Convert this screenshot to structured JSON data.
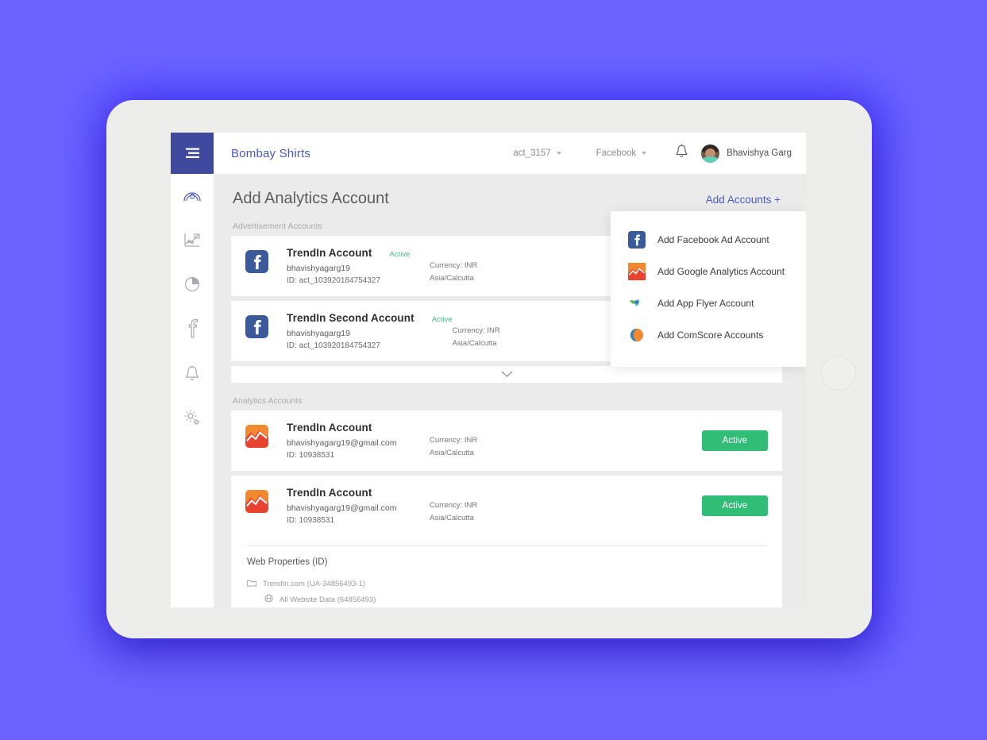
{
  "topbar": {
    "menu_icon": "hamburger-icon",
    "brand": "Bombay Shirts",
    "account_select": "act_3157",
    "platform_select": "Facebook",
    "bell_icon": "bell-icon",
    "user_name": "Bhavishya Garg"
  },
  "sidebar": {
    "items": [
      {
        "icon": "speedometer-icon",
        "active": true
      },
      {
        "icon": "line-chart-icon",
        "active": false
      },
      {
        "icon": "pie-chart-icon",
        "active": false
      },
      {
        "icon": "facebook-icon",
        "active": false
      },
      {
        "icon": "bell-icon",
        "active": false
      },
      {
        "icon": "settings-gears-icon",
        "active": false
      }
    ]
  },
  "page": {
    "title": "Add Analytics Account",
    "add_accounts_label": "Add Accounts +"
  },
  "dropdown": {
    "items": [
      {
        "icon": "facebook-icon",
        "label": "Add Facebook Ad Account"
      },
      {
        "icon": "google-analytics-icon",
        "label": "Add Google Analytics Account"
      },
      {
        "icon": "appsflyer-icon",
        "label": "Add App Flyer Account"
      },
      {
        "icon": "comscore-icon",
        "label": "Add ComScore Accounts"
      }
    ]
  },
  "ad_section": {
    "label": "Advertisement Accounts",
    "cards": [
      {
        "icon": "facebook-icon",
        "name": "TrendIn Account",
        "status": "Active",
        "username": "bhavishyagarg19",
        "id": "ID: act_103920184754327",
        "currency": "Currency: INR",
        "timezone": "Asia/Calcutta"
      },
      {
        "icon": "facebook-icon",
        "name": "TrendIn Second Account",
        "status": "Active",
        "username": "bhavishyagarg19",
        "id": "ID: act_103920184754327",
        "currency": "Currency: INR",
        "timezone": "Asia/Calcutta"
      }
    ],
    "expander_icon": "chevron-down-icon"
  },
  "analytics_section": {
    "label": "Analytics Accounts",
    "cards": [
      {
        "icon": "google-analytics-icon",
        "name": "TrendIn Account",
        "username": "bhavishyagarg19@gmail.com",
        "id": "ID: 10938531",
        "currency": "Currency: INR",
        "timezone": "Asia/Calcutta",
        "button": "Active"
      },
      {
        "icon": "google-analytics-icon",
        "name": "TrendIn Account",
        "username": "bhavishyagarg19@gmail.com",
        "id": "ID: 10938531",
        "currency": "Currency: INR",
        "timezone": "Asia/Calcutta",
        "button": "Active"
      }
    ]
  },
  "web_properties": {
    "title": "Web Properties (ID)",
    "rows": [
      {
        "icon": "folder-icon",
        "label": "TrendIn.com (UA-34856493-1)"
      },
      {
        "icon": "globe-icon",
        "label": "All Website Data (64856493)"
      }
    ]
  },
  "colors": {
    "background": "#6C63FF",
    "accent": "#4a59c4",
    "menu_block": "#3f4a9e",
    "status_green": "#32bd77",
    "card_bg": "#ffffff",
    "app_bg": "#ebebeb"
  }
}
